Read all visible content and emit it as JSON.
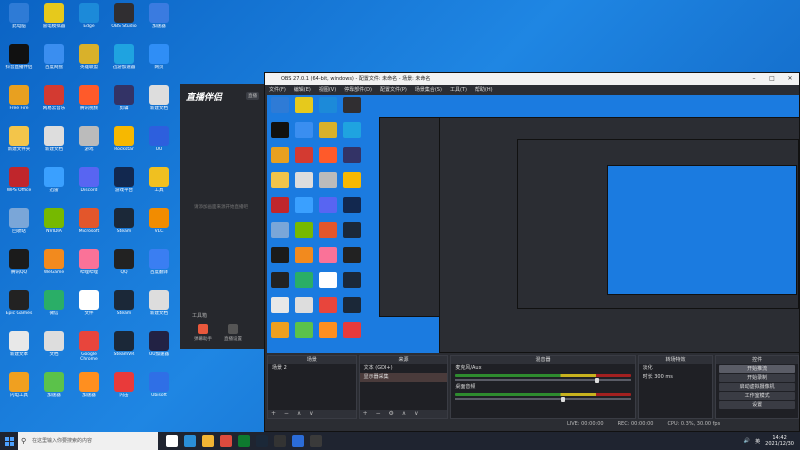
{
  "desktop": {
    "icons": [
      {
        "label": "此电脑",
        "color": "#2e7bd6"
      },
      {
        "label": "抖音直播伴侣",
        "color": "#111111"
      },
      {
        "label": "Free Fire",
        "color": "#e8a020"
      },
      {
        "label": "新建文件夹",
        "color": "#f3c54a"
      },
      {
        "label": "WPS Office",
        "color": "#c0262c"
      },
      {
        "label": "回收站",
        "color": "#7aa6d8"
      },
      {
        "label": "腾讯QQ",
        "color": "#1b1b1b"
      },
      {
        "label": "Epic Games",
        "color": "#222222"
      },
      {
        "label": "新建文本",
        "color": "#e8e8e8"
      },
      {
        "label": "闪电工具",
        "color": "#f0a020"
      },
      {
        "label": "雷电模拟器",
        "color": "#e6c91c"
      },
      {
        "label": "百度网盘",
        "color": "#3a8ef0"
      },
      {
        "label": "网易云音乐",
        "color": "#d33a31"
      },
      {
        "label": "新建文档",
        "color": "#dddddd"
      },
      {
        "label": "迅雷",
        "color": "#3aa0ff"
      },
      {
        "label": "NVIDIA",
        "color": "#76b900"
      },
      {
        "label": "WeGame",
        "color": "#f28a1e"
      },
      {
        "label": "微信",
        "color": "#2aae67"
      },
      {
        "label": "文档",
        "color": "#dddddd"
      },
      {
        "label": "加速器",
        "color": "#5bc24a"
      },
      {
        "label": "Edge",
        "color": "#1c8ad9"
      },
      {
        "label": "英雄联盟",
        "color": "#d9b12a"
      },
      {
        "label": "腾讯视频",
        "color": "#ff5a2a"
      },
      {
        "label": "游戏",
        "color": "#bbbbbb"
      },
      {
        "label": "Discord",
        "color": "#5865f2"
      },
      {
        "label": "Microsoft",
        "color": "#e3562b"
      },
      {
        "label": "哔哩哔哩",
        "color": "#fa7298"
      },
      {
        "label": "文件",
        "color": "#ffffff"
      },
      {
        "label": "Google Chrome",
        "color": "#e8453c"
      },
      {
        "label": "加速器",
        "color": "#ff8f1f"
      },
      {
        "label": "OBS Studio",
        "color": "#302e31"
      },
      {
        "label": "迅游加速器",
        "color": "#1fa3e0"
      },
      {
        "label": "剪辑",
        "color": "#333366"
      },
      {
        "label": "Rockstar",
        "color": "#f7b800"
      },
      {
        "label": "游戏平台",
        "color": "#12284f"
      },
      {
        "label": "Steam",
        "color": "#1b2838"
      },
      {
        "label": "QQ",
        "color": "#222222"
      },
      {
        "label": "Steam",
        "color": "#1b2838"
      },
      {
        "label": "SteamVR",
        "color": "#1b2838"
      },
      {
        "label": "闪击",
        "color": "#e93a3a"
      },
      {
        "label": "加速器",
        "color": "#3a7be0"
      },
      {
        "label": "网页",
        "color": "#2f8ef6"
      },
      {
        "label": "新建文档",
        "color": "#dddddd"
      },
      {
        "label": "UU",
        "color": "#2d5fdd"
      },
      {
        "label": "工具",
        "color": "#f0c020"
      },
      {
        "label": "VLC",
        "color": "#f28c00"
      },
      {
        "label": "百度翻译",
        "color": "#3a7ef2"
      },
      {
        "label": "新建文档",
        "color": "#dddddd"
      },
      {
        "label": "UU加速器",
        "color": "#222244"
      },
      {
        "label": "Ubisoft",
        "color": "#2f6fe6"
      }
    ]
  },
  "streamer": {
    "logo": "直播伴侣",
    "badge": "直播",
    "hint": "请添加画面来源开始直播吧",
    "tools_label": "工具箱",
    "tools": [
      "弹幕助手",
      "直播设置",
      "小工具",
      "更多"
    ],
    "footer": "欢迎使用主播助手"
  },
  "obs": {
    "title": "OBS 27.0.1 (64-bit, windows) - 配置文件: 未命名 - 场景: 未命名",
    "menu": [
      "文件(F)",
      "编辑(E)",
      "视图(V)",
      "停靠部件(D)",
      "配置文件(P)",
      "场景集合(S)",
      "工具(T)",
      "帮助(H)"
    ],
    "docks": {
      "scenes": {
        "header": "场景",
        "items": [
          "场景 2"
        ],
        "toolbar": "+ − ∧ ∨"
      },
      "sources": {
        "header": "来源",
        "items": [
          "文本 (GDI+)",
          "显示器采集"
        ],
        "toolbar": "+ − ⚙ ∧ ∨"
      },
      "mixer": {
        "header": "混音器",
        "channels": [
          {
            "name": "麦克风/Aux",
            "level": 0.82
          },
          {
            "name": "桌面音频",
            "level": 0.62
          }
        ]
      },
      "transitions": {
        "header": "转场特效",
        "type": "淡化",
        "duration_label": "时长",
        "duration": "300 ms"
      },
      "controls": {
        "header": "控件",
        "buttons": [
          "开始推流",
          "开始录制",
          "启动虚拟摄像机",
          "工作室模式",
          "设置",
          "退出"
        ]
      }
    },
    "status": {
      "live": "LIVE: 00:00:00",
      "rec": "REC: 00:00:00",
      "cpu": "CPU: 0.3%, 30.00 fps"
    }
  },
  "taskbar": {
    "search_placeholder": "在这里输入你要搜索的内容",
    "apps": [
      "#ffffff",
      "#2a8fd8",
      "#f2b534",
      "#dd4b3e",
      "#0e7a2f",
      "#1b2838",
      "#333333",
      "#2b6cd8",
      "#3a3a3a"
    ],
    "time": "14:42",
    "date": "2021/12/30",
    "lang": "英"
  }
}
